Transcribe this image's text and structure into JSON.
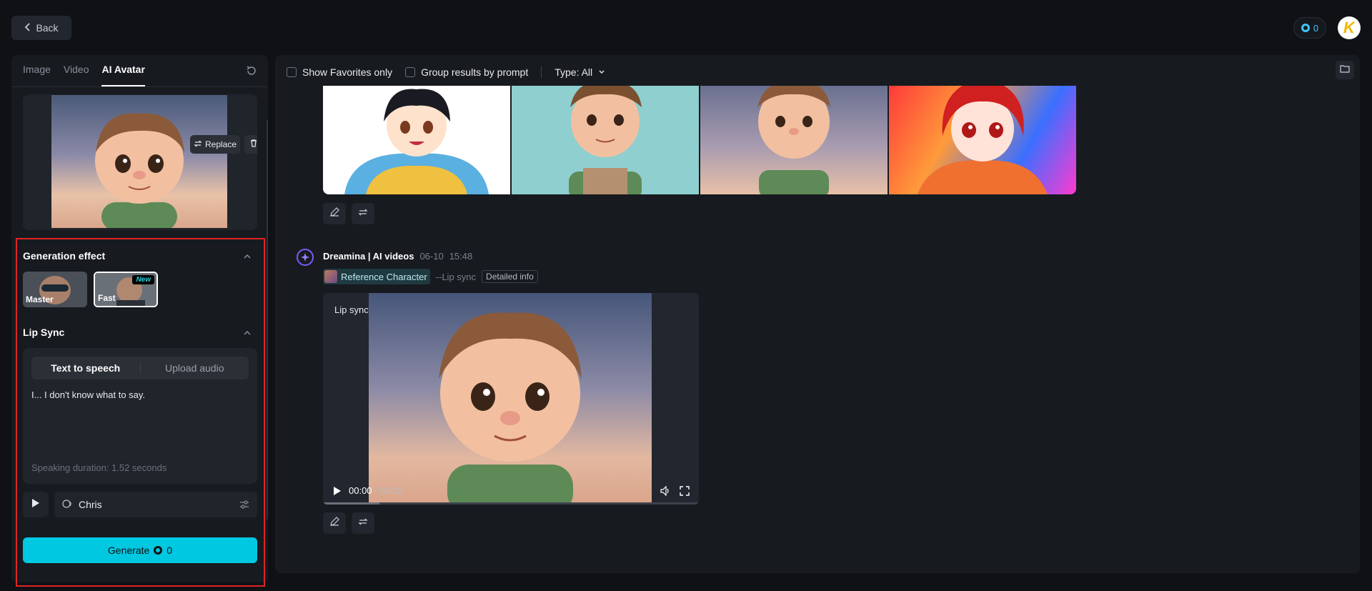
{
  "header": {
    "back_label": "Back",
    "credits": "0"
  },
  "left": {
    "tabs": [
      {
        "label": "Image",
        "active": false
      },
      {
        "label": "Video",
        "active": false
      },
      {
        "label": "AI Avatar",
        "active": true
      }
    ],
    "reference": {
      "replace_label": "Replace"
    },
    "generation_effect": {
      "title": "Generation effect",
      "options": [
        {
          "label": "Master",
          "selected": false
        },
        {
          "label": "Fast",
          "selected": true,
          "badge": "New"
        }
      ]
    },
    "lip_sync": {
      "title": "Lip Sync",
      "modes": [
        {
          "label": "Text to speech",
          "active": true
        },
        {
          "label": "Upload audio",
          "active": false
        }
      ],
      "text": "I... I don't know what to say.",
      "duration": "Speaking duration: 1.52 seconds",
      "voice": "Chris"
    },
    "generate": {
      "label": "Generate",
      "cost": "0"
    }
  },
  "right": {
    "filters": {
      "favorites": "Show Favorites only",
      "group": "Group results by prompt",
      "type": "Type: All"
    },
    "generation": {
      "source": "Dreamina | AI videos",
      "date": "06-10",
      "time": "15:48",
      "ref_label": "Reference Character",
      "mode_label": "--Lip sync",
      "detail_label": "Detailed info"
    },
    "video": {
      "label": "Lip sync",
      "current_time": "00:00",
      "total_time": "/ 00:02",
      "progress": 0.15
    }
  },
  "colors": {
    "accent": "#00c8e0",
    "outline": "#e02424",
    "credit": "#3fc3ff"
  }
}
